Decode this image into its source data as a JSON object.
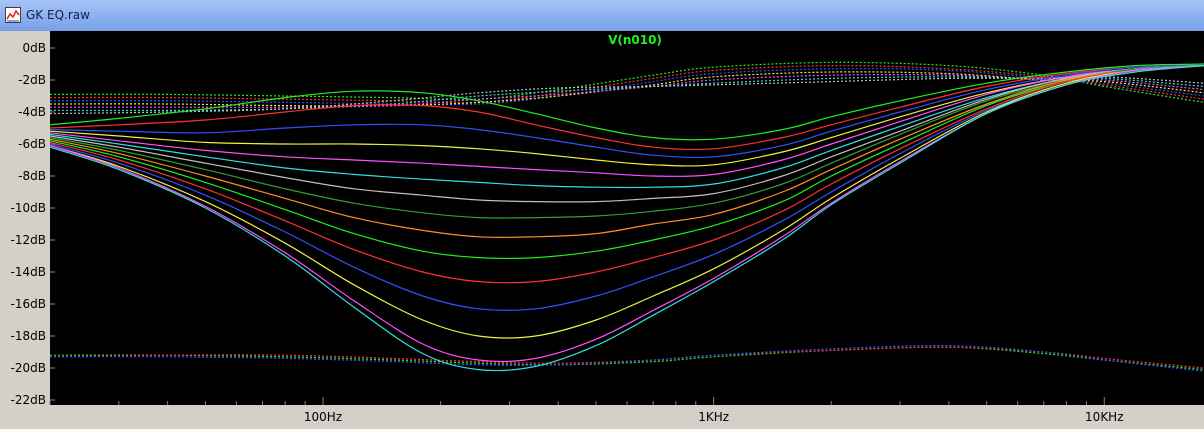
{
  "window": {
    "title": "GK EQ.raw",
    "icon": "chart-window-icon"
  },
  "chart_data": {
    "type": "line",
    "title": "V(n010)",
    "xlabel": "",
    "ylabel": "",
    "x_scale": "log",
    "xlim": [
      20,
      18000
    ],
    "ylim": [
      -22,
      0
    ],
    "grid": false,
    "background": "#000000",
    "title_color": "#1ff01f",
    "y_ticks": [
      0,
      -2,
      -4,
      -6,
      -8,
      -10,
      -12,
      -14,
      -16,
      -18,
      -20,
      -22
    ],
    "y_tick_labels": [
      "0dB",
      "-2dB",
      "-4dB",
      "-6dB",
      "-8dB",
      "-10dB",
      "-12dB",
      "-14dB",
      "-16dB",
      "-18dB",
      "-20dB",
      "-22dB"
    ],
    "x_ticks": [
      100,
      1000,
      10000
    ],
    "x_tick_labels": [
      "100Hz",
      "1KHz",
      "10KHz"
    ],
    "series_colors": [
      "#1ff01f",
      "#ff3030",
      "#3050ff",
      "#f0f040",
      "#ff50ff",
      "#30e0e0",
      "#c0c0c0",
      "#30a030",
      "#ff9020"
    ],
    "magnitude_families": {
      "style": "solid",
      "freq_hz": [
        20,
        30,
        50,
        80,
        120,
        180,
        250,
        350,
        500,
        700,
        1000,
        1500,
        2000,
        3000,
        5000,
        8000,
        12000,
        18000
      ],
      "curves": [
        [
          -4.8,
          -4.4,
          -3.8,
          -3.1,
          -2.7,
          -2.8,
          -3.3,
          -4.1,
          -5.0,
          -5.6,
          -5.7,
          -5.1,
          -4.3,
          -3.3,
          -2.2,
          -1.5,
          -1.1,
          -1.0
        ],
        [
          -5.0,
          -4.8,
          -4.5,
          -4.0,
          -3.6,
          -3.6,
          -4.0,
          -4.8,
          -5.6,
          -6.2,
          -6.3,
          -5.6,
          -4.8,
          -3.7,
          -2.4,
          -1.6,
          -1.2,
          -1.1
        ],
        [
          -5.1,
          -5.2,
          -5.3,
          -5.0,
          -4.8,
          -4.8,
          -5.1,
          -5.6,
          -6.2,
          -6.7,
          -6.8,
          -6.1,
          -5.2,
          -4.0,
          -2.6,
          -1.7,
          -1.2,
          -1.1
        ],
        [
          -5.2,
          -5.5,
          -5.9,
          -6.0,
          -6.0,
          -6.1,
          -6.3,
          -6.6,
          -7.0,
          -7.3,
          -7.3,
          -6.5,
          -5.6,
          -4.3,
          -2.8,
          -1.8,
          -1.3,
          -1.1
        ],
        [
          -5.3,
          -5.8,
          -6.4,
          -6.8,
          -7.0,
          -7.2,
          -7.4,
          -7.6,
          -7.8,
          -8.0,
          -7.9,
          -7.0,
          -6.0,
          -4.6,
          -2.9,
          -1.8,
          -1.3,
          -1.1
        ],
        [
          -5.4,
          -6.0,
          -6.8,
          -7.5,
          -7.9,
          -8.2,
          -8.4,
          -8.6,
          -8.7,
          -8.7,
          -8.5,
          -7.5,
          -6.4,
          -4.9,
          -3.1,
          -1.9,
          -1.3,
          -1.1
        ],
        [
          -5.5,
          -6.2,
          -7.2,
          -8.1,
          -8.8,
          -9.2,
          -9.5,
          -9.6,
          -9.6,
          -9.4,
          -9.1,
          -8.0,
          -6.8,
          -5.2,
          -3.2,
          -1.9,
          -1.3,
          -1.1
        ],
        [
          -5.6,
          -6.4,
          -7.6,
          -8.8,
          -9.7,
          -10.3,
          -10.6,
          -10.6,
          -10.5,
          -10.2,
          -9.7,
          -8.5,
          -7.2,
          -5.4,
          -3.3,
          -2.0,
          -1.3,
          -1.1
        ],
        [
          -5.7,
          -6.6,
          -8.0,
          -9.4,
          -10.6,
          -11.4,
          -11.8,
          -11.8,
          -11.6,
          -11.0,
          -10.4,
          -9.0,
          -7.6,
          -5.7,
          -3.5,
          -2.0,
          -1.4,
          -1.1
        ],
        [
          -5.8,
          -6.8,
          -8.4,
          -10.1,
          -11.6,
          -12.7,
          -13.1,
          -13.1,
          -12.7,
          -12.0,
          -11.1,
          -9.6,
          -8.0,
          -6.0,
          -3.6,
          -2.1,
          -1.4,
          -1.1
        ],
        [
          -5.9,
          -7.0,
          -8.8,
          -10.8,
          -12.6,
          -14.0,
          -14.6,
          -14.6,
          -14.0,
          -13.1,
          -12.0,
          -10.2,
          -8.5,
          -6.3,
          -3.8,
          -2.1,
          -1.4,
          -1.1
        ],
        [
          -6.0,
          -7.2,
          -9.2,
          -11.5,
          -13.7,
          -15.5,
          -16.3,
          -16.3,
          -15.5,
          -14.3,
          -12.9,
          -10.8,
          -9.0,
          -6.6,
          -3.9,
          -2.2,
          -1.4,
          -1.1
        ],
        [
          -6.1,
          -7.4,
          -9.6,
          -12.2,
          -14.8,
          -17.0,
          -18.0,
          -18.0,
          -17.0,
          -15.5,
          -13.8,
          -11.4,
          -9.4,
          -6.9,
          -4.0,
          -2.2,
          -1.4,
          -1.1
        ],
        [
          -6.1,
          -7.5,
          -9.9,
          -12.8,
          -15.8,
          -18.5,
          -19.5,
          -19.4,
          -18.2,
          -16.4,
          -14.4,
          -11.8,
          -9.7,
          -7.1,
          -4.1,
          -2.3,
          -1.4,
          -1.1
        ],
        [
          -6.2,
          -7.6,
          -10.0,
          -13.0,
          -16.2,
          -19.1,
          -20.1,
          -19.9,
          -18.6,
          -16.7,
          -14.6,
          -12.0,
          -9.8,
          -7.2,
          -4.1,
          -2.3,
          -1.5,
          -1.1
        ]
      ]
    },
    "upper_phase_family": {
      "style": "dotted",
      "freq_hz": [
        20,
        40,
        80,
        150,
        250,
        400,
        700,
        1000,
        2000,
        4000,
        7000,
        10000,
        18000
      ],
      "curves": [
        [
          -2.9,
          -2.9,
          -3.0,
          -3.1,
          -3.2,
          -2.6,
          -1.7,
          -1.2,
          -0.9,
          -1.1,
          -1.7,
          -2.4,
          -3.4
        ],
        [
          -3.1,
          -3.1,
          -3.2,
          -3.3,
          -3.4,
          -2.8,
          -1.9,
          -1.4,
          -1.1,
          -1.3,
          -1.8,
          -2.3,
          -3.2
        ],
        [
          -3.3,
          -3.3,
          -3.4,
          -3.5,
          -3.5,
          -3.0,
          -2.1,
          -1.6,
          -1.3,
          -1.4,
          -1.9,
          -2.2,
          -3.0
        ],
        [
          -3.5,
          -3.5,
          -3.6,
          -3.6,
          -3.4,
          -3.0,
          -2.3,
          -1.8,
          -1.5,
          -1.6,
          -2.0,
          -2.1,
          -2.8
        ],
        [
          -3.7,
          -3.7,
          -3.7,
          -3.6,
          -3.2,
          -2.9,
          -2.4,
          -2.0,
          -1.7,
          -1.7,
          -2.0,
          -2.0,
          -2.6
        ],
        [
          -3.9,
          -3.9,
          -3.8,
          -3.5,
          -3.0,
          -2.7,
          -2.4,
          -2.2,
          -1.9,
          -1.8,
          -1.9,
          -1.9,
          -2.4
        ],
        [
          -4.1,
          -4.0,
          -3.8,
          -3.3,
          -2.8,
          -2.5,
          -2.4,
          -2.3,
          -2.1,
          -1.9,
          -1.9,
          -1.8,
          -2.2
        ]
      ]
    },
    "lower_phase_family": {
      "style": "dotted",
      "freq_hz": [
        20,
        40,
        80,
        150,
        250,
        400,
        700,
        1000,
        2000,
        4000,
        7000,
        10000,
        18000
      ],
      "curves": [
        [
          -19.2,
          -19.2,
          -19.3,
          -19.5,
          -19.7,
          -19.8,
          -19.6,
          -19.3,
          -18.9,
          -18.7,
          -19.1,
          -19.5,
          -20.1
        ],
        [
          -19.3,
          -19.2,
          -19.2,
          -19.4,
          -19.6,
          -19.7,
          -19.5,
          -19.2,
          -18.9,
          -18.7,
          -19.0,
          -19.4,
          -20.0
        ],
        [
          -19.3,
          -19.3,
          -19.4,
          -19.6,
          -19.8,
          -19.8,
          -19.5,
          -19.2,
          -18.8,
          -18.6,
          -19.0,
          -19.5,
          -20.2
        ]
      ]
    }
  }
}
